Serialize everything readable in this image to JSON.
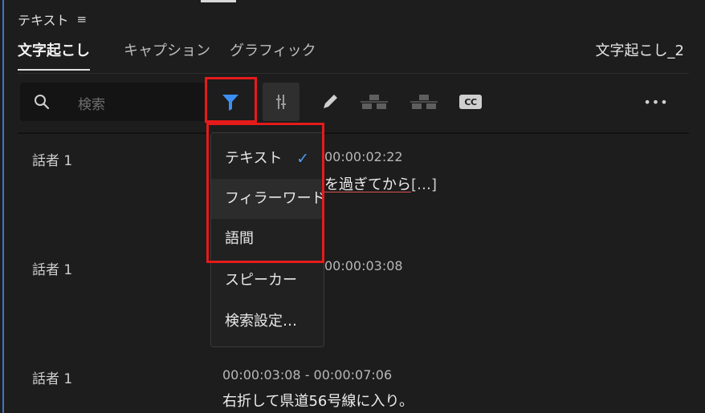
{
  "panel": {
    "title": "テキスト",
    "menu_icon": "≡"
  },
  "tabs": [
    {
      "label": "文字起こし",
      "active": true
    },
    {
      "label": "キャプション",
      "active": false
    },
    {
      "label": "グラフィック",
      "active": false
    }
  ],
  "sequence_name": "文字起こし_2",
  "search": {
    "placeholder": "検索"
  },
  "toolbar": {
    "icons": [
      "filter-icon",
      "adjust-icon",
      "pencil-icon",
      "merge-segment-icon",
      "split-segment-icon",
      "cc-icon",
      "more-icon"
    ],
    "cc_label": "CC",
    "more_label": "•••"
  },
  "dropdown": {
    "items": [
      {
        "label": "テキスト",
        "checked": true
      },
      {
        "label": "フィラーワード",
        "checked": false
      },
      {
        "label": "語間",
        "checked": false
      },
      {
        "label": "スピーカー",
        "checked": false
      },
      {
        "label": "検索設定…",
        "checked": false
      }
    ],
    "check_mark": "✓"
  },
  "segments": [
    {
      "speaker": "話者 1",
      "time": "00:00:02:22",
      "text_underlined": "を過ぎてから",
      "text_more": "[…]"
    },
    {
      "speaker": "話者 1",
      "time": "00:00:03:08",
      "text_underlined": "",
      "text_more": ""
    },
    {
      "speaker": "話者 1",
      "time": "00:00:03:08 - 00:00:07:06",
      "text": "右折して県道56号線に入り。"
    }
  ],
  "colors": {
    "accent": "#3b8ff2",
    "highlight_box": "#e51b1b",
    "background": "#1d1d1d"
  }
}
